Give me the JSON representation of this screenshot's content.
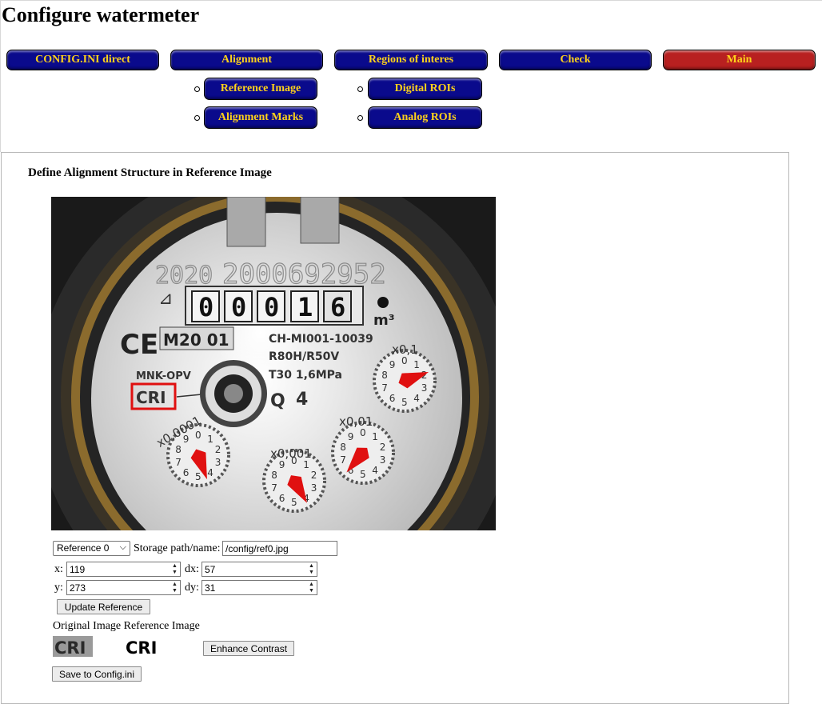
{
  "page": {
    "title": "Configure watermeter"
  },
  "nav": {
    "config": "CONFIG.INI direct",
    "alignment": "Alignment",
    "roi": "Regions of interes",
    "check": "Check",
    "main": "Main",
    "reference_image": "Reference Image",
    "alignment_marks": "Alignment Marks",
    "digital_rois": "Digital ROIs",
    "analog_rois": "Analog ROIs"
  },
  "section": {
    "title": "Define Alignment Structure in Reference Image"
  },
  "meter": {
    "year": "2020",
    "serial": "2000692952",
    "digits": [
      "0",
      "0",
      "0",
      "1",
      "6"
    ],
    "unit": "m³",
    "ce": "CE",
    "m20": "M20 01",
    "model": "CH-MI001-10039",
    "ratio": "R80H/R50V",
    "temp": "T30  1,6MPa",
    "mnk": "MNK-OPV",
    "cri": "CRI",
    "q": "Q",
    "q_val": "4",
    "dials": [
      "x0,1",
      "x0,0001",
      "x0,001",
      "x0,01"
    ]
  },
  "form": {
    "reference_select": "Reference 0",
    "storage_label": "Storage path/name:",
    "storage_value": "/config/ref0.jpg",
    "x_label": "x:",
    "x_value": "119",
    "dx_label": "dx:",
    "dx_value": "57",
    "y_label": "y:",
    "y_value": "273",
    "dy_label": "dy:",
    "dy_value": "31",
    "update_button": "Update Reference",
    "orig_ref_label": "Original Image Reference Image",
    "enhance_button": "Enhance Contrast",
    "save_button": "Save to Config.ini"
  },
  "colors": {
    "nav_blue": "#0a0a8c",
    "nav_red": "#b82020",
    "nav_text": "#ffd21a",
    "marker_red": "#e01010"
  }
}
